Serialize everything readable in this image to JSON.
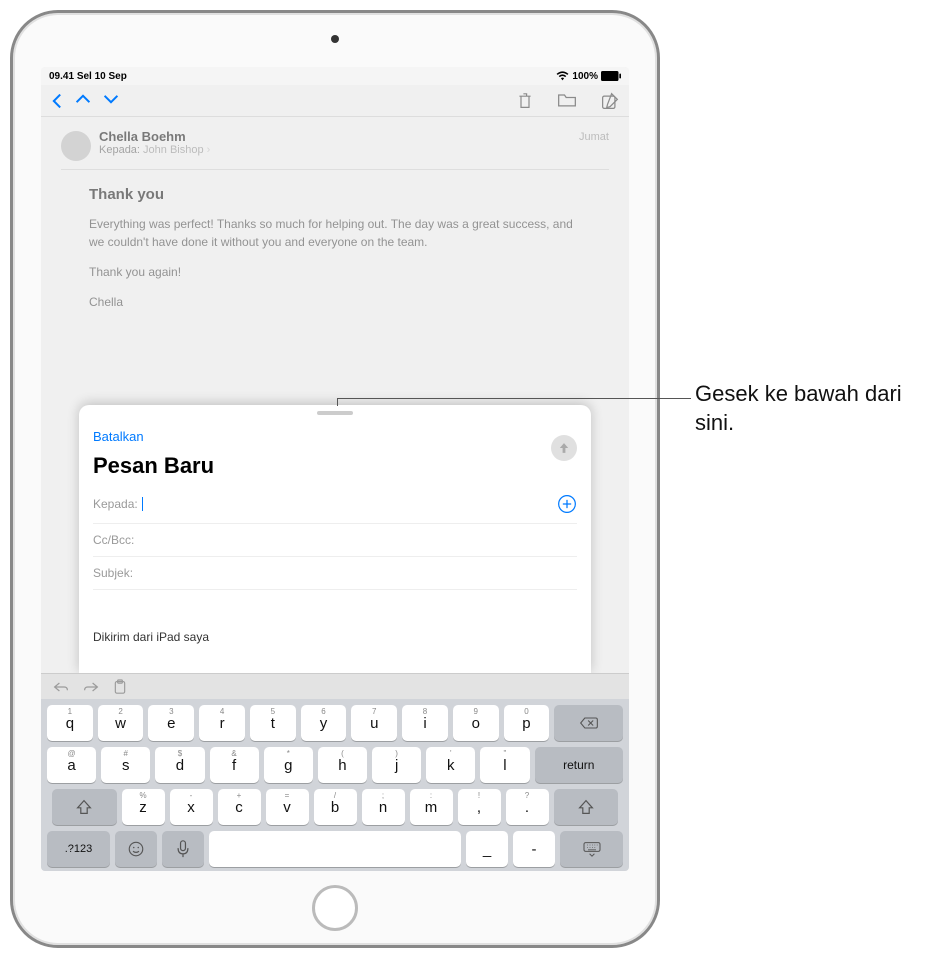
{
  "statusBar": {
    "time": "09.41",
    "date": "Sel 10 Sep",
    "wifi": "wifi",
    "battery": "100%"
  },
  "mailToolbar": {
    "back": "back",
    "up": "up",
    "down": "down",
    "trash": "trash",
    "folder": "folder",
    "compose": "compose"
  },
  "backgroundMessage": {
    "sender": "Chella Boehm",
    "kepadaLabel": "Kepada:",
    "recipient": "John Bishop",
    "dateLabel": "Jumat",
    "subject": "Thank you",
    "bodyP1": "Everything was perfect! Thanks so much for helping out. The day was a great success, and we couldn't have done it without you and everyone on the team.",
    "bodyP2": "Thank you again!",
    "bodyP3": "Chella"
  },
  "compose": {
    "cancel": "Batalkan",
    "title": "Pesan Baru",
    "toLabel": "Kepada:",
    "ccLabel": "Cc/Bcc:",
    "subjectLabel": "Subjek:",
    "signature": "Dikirim dari iPad saya"
  },
  "keyboard": {
    "row1": [
      {
        "main": "q",
        "alt": "1"
      },
      {
        "main": "w",
        "alt": "2"
      },
      {
        "main": "e",
        "alt": "3"
      },
      {
        "main": "r",
        "alt": "4"
      },
      {
        "main": "t",
        "alt": "5"
      },
      {
        "main": "y",
        "alt": "6"
      },
      {
        "main": "u",
        "alt": "7"
      },
      {
        "main": "i",
        "alt": "8"
      },
      {
        "main": "o",
        "alt": "9"
      },
      {
        "main": "p",
        "alt": "0"
      }
    ],
    "row2": [
      {
        "main": "a",
        "alt": "@"
      },
      {
        "main": "s",
        "alt": "#"
      },
      {
        "main": "d",
        "alt": "$"
      },
      {
        "main": "f",
        "alt": "&"
      },
      {
        "main": "g",
        "alt": "*"
      },
      {
        "main": "h",
        "alt": "("
      },
      {
        "main": "j",
        "alt": ")"
      },
      {
        "main": "k",
        "alt": "'"
      },
      {
        "main": "l",
        "alt": "\""
      }
    ],
    "row3": [
      {
        "main": "z",
        "alt": "%"
      },
      {
        "main": "x",
        "alt": "-"
      },
      {
        "main": "c",
        "alt": "+"
      },
      {
        "main": "v",
        "alt": "="
      },
      {
        "main": "b",
        "alt": "/"
      },
      {
        "main": "n",
        "alt": ";"
      },
      {
        "main": "m",
        "alt": ":"
      },
      {
        "main": ",",
        "alt": "!"
      },
      {
        "main": ".",
        "alt": "?"
      }
    ],
    "numKey": ".?123",
    "returnKey": "return",
    "dash1": "_",
    "dash2": "-"
  },
  "callout": {
    "text": "Gesek ke bawah dari sini."
  }
}
